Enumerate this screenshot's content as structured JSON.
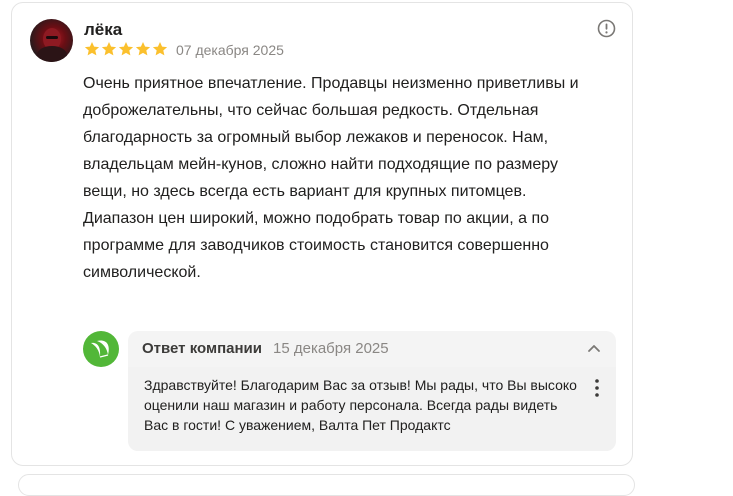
{
  "review": {
    "author": "лёка",
    "rating": 5,
    "date": "07 декабря 2025",
    "text": "Очень приятное впечатление. Продавцы неизменно приветливы и доброжелательны, что сейчас большая редкость. Отдельная благодарность за огромный выбор лежаков и переносок. Нам, владельцам мейн-кунов, сложно найти подходящие по размеру вещи, но здесь всегда есть вариант для крупных питомцев. Диапазон цен широкий, можно подобрать товар по акции, а по программе для заводчиков стоимость становится совершенно символической."
  },
  "reply": {
    "title": "Ответ компании",
    "date": "15 декабря 2025",
    "text": "Здравствуйте! Благодарим Вас за отзыв! Мы рады, что Вы высоко оценили наш магазин и работу персонала. Всегда рады видеть Вас в гости! С уважением, Валта Пет Продактс"
  },
  "icons": {
    "report": "exclamation-circle-icon",
    "star": "star-icon",
    "collapse": "chevron-up-icon",
    "more": "vertical-dots-icon",
    "company_logo": "company-logo-icon"
  },
  "colors": {
    "star": "#fbc02d",
    "company_logo": "#52b738",
    "reply_background": "#f4f4f4",
    "muted_text": "#8a8784"
  }
}
